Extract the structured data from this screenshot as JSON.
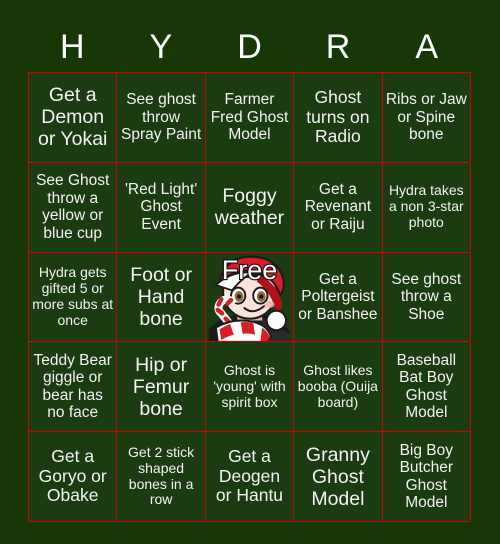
{
  "card": {
    "header_letters": [
      "H",
      "Y",
      "D",
      "R",
      "A"
    ],
    "background_color": "#173806",
    "cell_color": "#1b3c10",
    "grid_line_color": "#cc0000",
    "text_color": "#f2f2f2",
    "free_label": "Free",
    "rows": [
      [
        "Get a Demon or Yokai",
        "See ghost throw Spray Paint",
        "Farmer Fred Ghost Model",
        "Ghost turns on Radio",
        "Ribs or Jaw or Spine bone"
      ],
      [
        "See Ghost throw a yellow or blue cup",
        "'Red Light' Ghost Event",
        "Foggy weather",
        "Get a Revenant or Raiju",
        "Hydra takes a non 3-star photo"
      ],
      [
        "Hydra gets gifted 5 or more subs at once",
        "Foot or Hand bone",
        "Free",
        "Get a Poltergeist or Banshee",
        "See ghost throw a Shoe"
      ],
      [
        "Teddy Bear giggle or bear has no face",
        "Hip or Femur bone",
        "Ghost is 'young' with spirit box",
        "Ghost likes booba (Ouija board)",
        "Baseball Bat Boy Ghost Model"
      ],
      [
        "Get a Goryo or Obake",
        "Get 2 stick shaped bones in a row",
        "Get a Deogen or Hantu",
        "Granny Ghost Model",
        "Big Boy Butcher Ghost Model"
      ]
    ]
  }
}
